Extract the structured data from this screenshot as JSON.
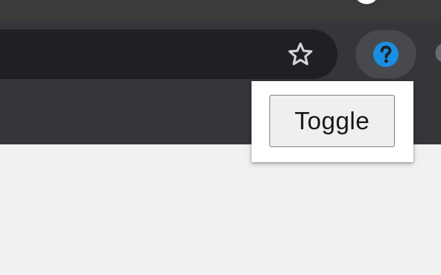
{
  "browser": {
    "toolbar": {
      "bookmark_icon": "star-outline-icon",
      "extension_icon": "help-circle-icon",
      "extension_icon_color": "#1a8ee0"
    }
  },
  "popup": {
    "toggle_label": "Toggle"
  },
  "colors": {
    "tabstrip": "#3c3b39",
    "toolbar": "#35363a",
    "omnibox": "#1f2024",
    "content_background": "#f1f1f1"
  }
}
